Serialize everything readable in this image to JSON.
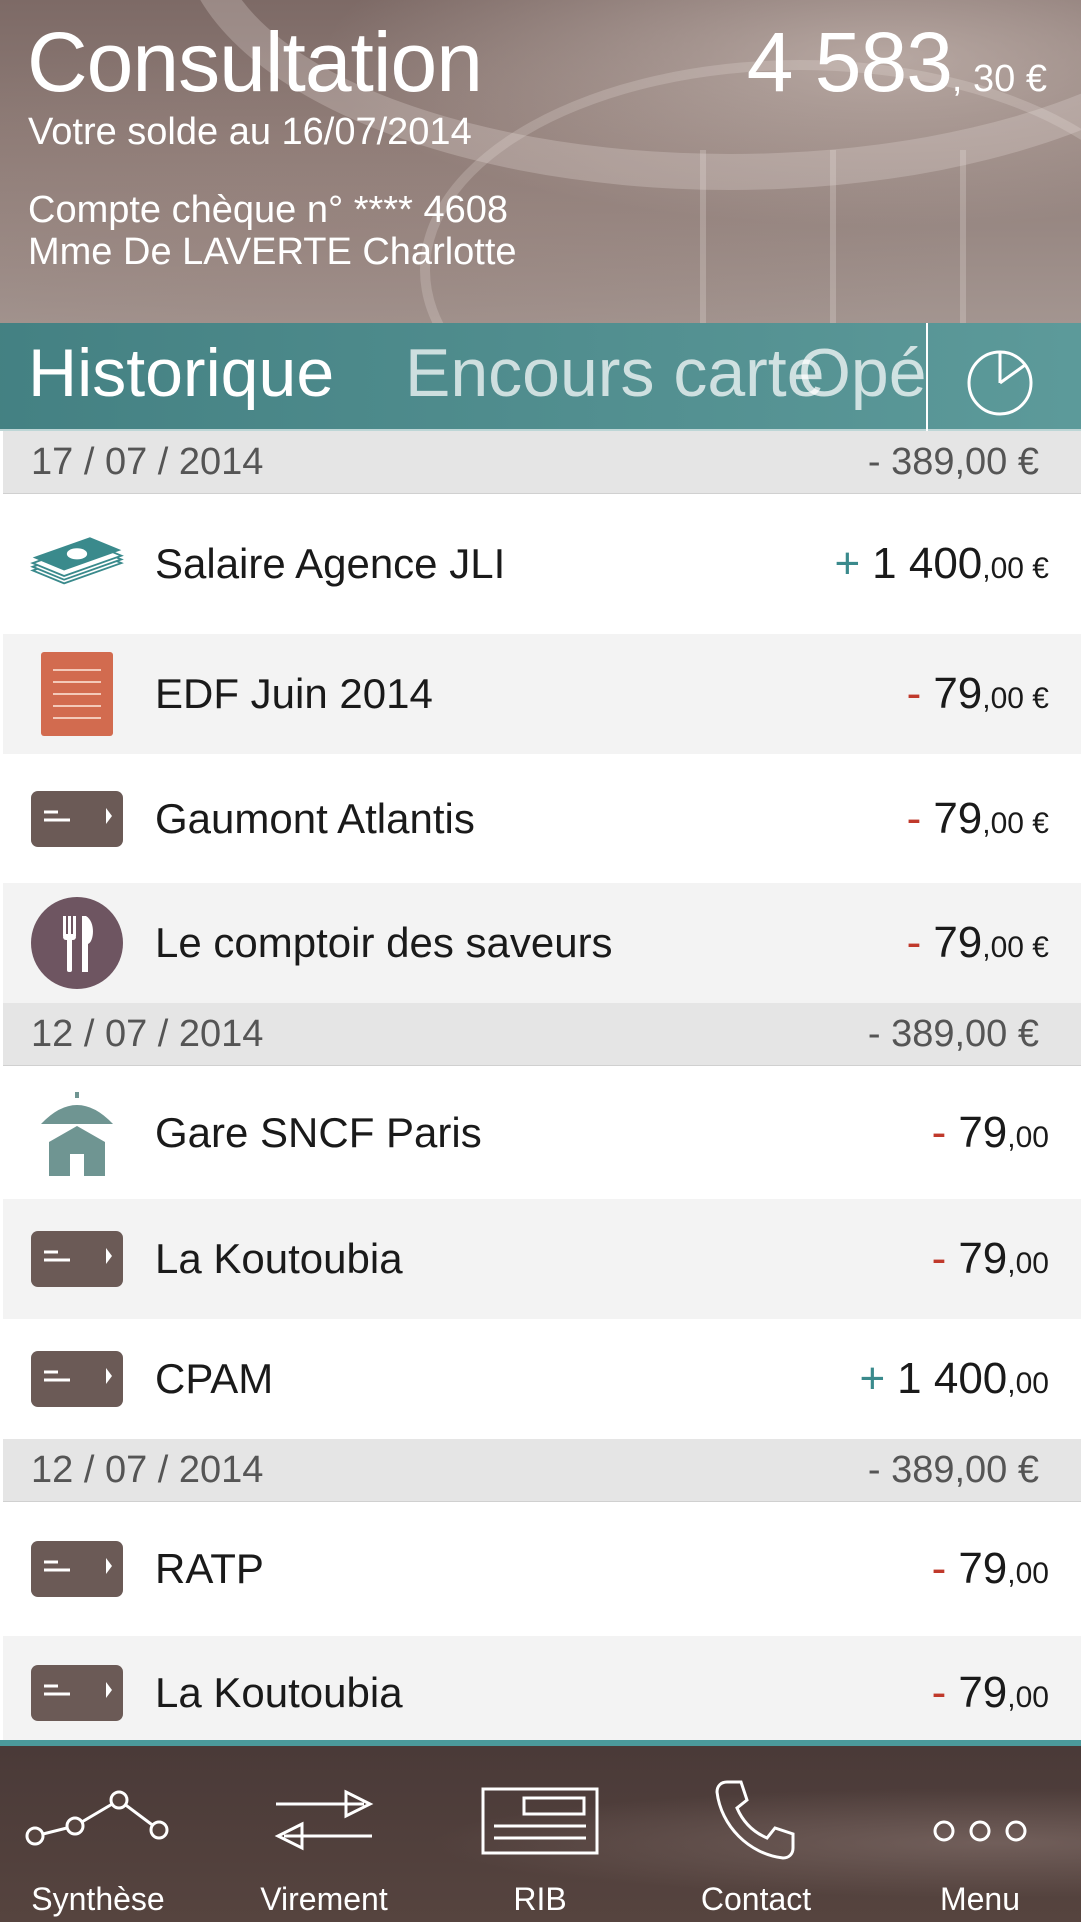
{
  "header": {
    "title": "Consultation",
    "balance_int": "4 583",
    "balance_dec": ", 30 €",
    "subtitle": "Votre solde au 16/07/2014",
    "account_number": "Compte chèque n° **** 4608",
    "account_holder": "Mme De LAVERTE Charlotte"
  },
  "tabs": {
    "historique": "Historique",
    "encours": "Encours carte",
    "ope": "Opé",
    "chart_icon": "pie-chart-icon"
  },
  "groups": [
    {
      "date": "17 / 07 / 2014",
      "total": "- 389,00 €",
      "items": [
        {
          "icon": "money-stack-icon",
          "label": "Salaire Agence JLI",
          "sign": "+",
          "int": "1 400",
          "cents": ",00 €"
        },
        {
          "icon": "bill-document-icon",
          "label": "EDF Juin 2014",
          "sign": "-",
          "int": "79",
          "cents": ",00 €"
        },
        {
          "icon": "card-icon",
          "label": "Gaumont Atlantis",
          "sign": "-",
          "int": "79",
          "cents": ",00 €"
        },
        {
          "icon": "restaurant-icon",
          "label": "Le comptoir des saveurs",
          "sign": "-",
          "int": "79",
          "cents": ",00 €"
        }
      ]
    },
    {
      "date": "12 / 07 / 2014",
      "total": "- 389,00 €",
      "items": [
        {
          "icon": "house-umbrella-icon",
          "label": "Gare SNCF Paris",
          "sign": "-",
          "int": "79",
          "cents": ",00"
        },
        {
          "icon": "card-icon",
          "label": "La Koutoubia",
          "sign": "-",
          "int": "79",
          "cents": ",00"
        },
        {
          "icon": "card-icon",
          "label": "CPAM",
          "sign": "+",
          "int": "1 400",
          "cents": ",00"
        }
      ]
    },
    {
      "date": "12 / 07 / 2014",
      "total": "- 389,00 €",
      "items": [
        {
          "icon": "card-icon",
          "label": "RATP",
          "sign": "-",
          "int": "79",
          "cents": ",00"
        },
        {
          "icon": "card-icon",
          "label": "La Koutoubia",
          "sign": "-",
          "int": "79",
          "cents": ",00"
        }
      ]
    }
  ],
  "nav": [
    {
      "label": "Synthèse",
      "icon": "line-chart-icon"
    },
    {
      "label": "Virement",
      "icon": "transfer-arrows-icon"
    },
    {
      "label": "RIB",
      "icon": "rib-card-icon"
    },
    {
      "label": "Contact",
      "icon": "phone-icon"
    },
    {
      "label": "Menu",
      "icon": "more-dots-icon"
    }
  ],
  "colors": {
    "teal": "#3a8a8c",
    "negative": "#c0392b",
    "card_icon": "#6b5a56",
    "bill_icon": "#d26b4f",
    "restaurant_icon": "#6e5561",
    "house_icon": "#6f9592"
  }
}
